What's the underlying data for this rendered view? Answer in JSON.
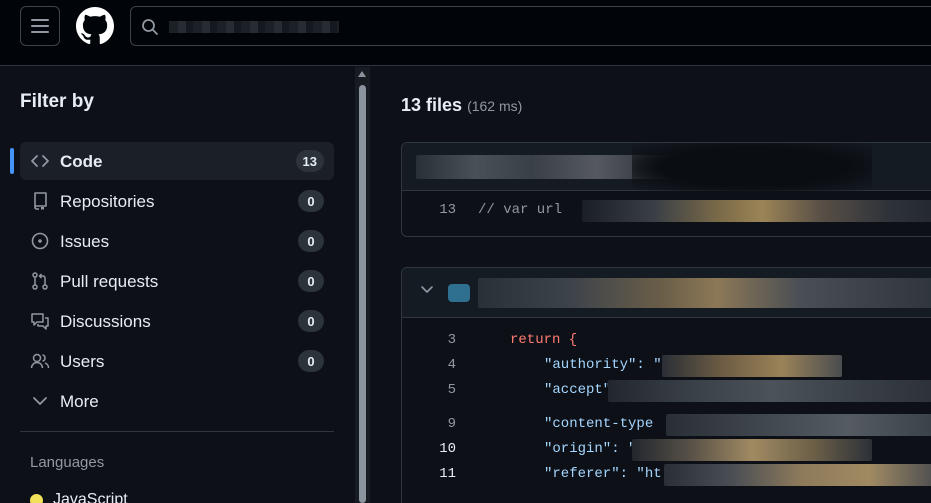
{
  "header": {
    "menu_icon": "hamburger-icon",
    "logo_icon": "github-logo-icon",
    "search_icon": "search-icon"
  },
  "sidebar": {
    "title": "Filter by",
    "items": [
      {
        "label": "Code",
        "count": "13",
        "icon": "code-icon",
        "active": true
      },
      {
        "label": "Repositories",
        "count": "0",
        "icon": "repo-icon"
      },
      {
        "label": "Issues",
        "count": "0",
        "icon": "issue-icon"
      },
      {
        "label": "Pull requests",
        "count": "0",
        "icon": "pull-request-icon"
      },
      {
        "label": "Discussions",
        "count": "0",
        "icon": "discussions-icon"
      },
      {
        "label": "Users",
        "count": "0",
        "icon": "people-icon"
      },
      {
        "label": "More",
        "icon": "chevron-down-icon"
      }
    ],
    "languages_title": "Languages",
    "languages": [
      {
        "label": "JavaScript",
        "color": "#f1e05a"
      }
    ]
  },
  "results": {
    "count_label": "13 files",
    "time_label": "(162 ms)",
    "card1": {
      "lines": [
        {
          "num": "13",
          "text": "// var url"
        }
      ]
    },
    "card2": {
      "lines": [
        {
          "num": "3",
          "text": "return {"
        },
        {
          "num": "4",
          "text": "\"authority\": \""
        },
        {
          "num": "5",
          "text": "\"accept\""
        },
        {
          "num": "9",
          "text": "\"content-type"
        },
        {
          "num": "10",
          "text": "\"origin\": \""
        },
        {
          "num": "11",
          "text": "\"referer\": \"ht"
        }
      ]
    }
  },
  "colors": {
    "accent": "#4493f8",
    "background": "#0d1117",
    "keyword": "#ff7b72",
    "string": "#a5d6ff"
  }
}
